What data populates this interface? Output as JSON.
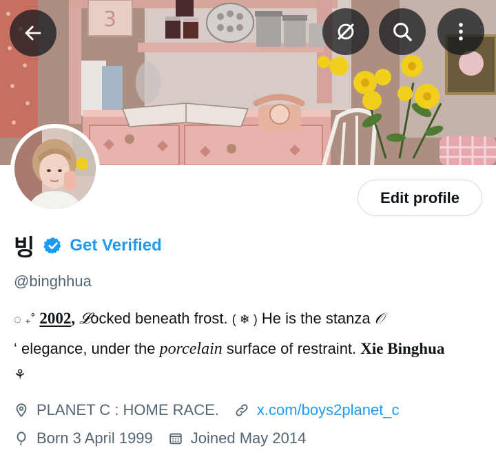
{
  "header": {
    "back_icon": "arrow-left-icon",
    "grok_icon": "grok-icon",
    "search_icon": "search-icon",
    "more_icon": "more-vertical-icon"
  },
  "profile": {
    "display_name": "빙",
    "verified_badge_icon": "verified-badge-icon",
    "get_verified_label": "Get Verified",
    "handle": "@binghhua",
    "edit_profile_label": "Edit profile"
  },
  "bio": {
    "line1": {
      "lead": "◌ ₊˚",
      "year": "2002",
      "comma": ",",
      "script_l": "𝓛",
      "text1": "ocked beneath frost.",
      "snow": "( ❄ )",
      "text2": "He is the stanza",
      "script_o": "𝒪"
    },
    "line2": {
      "tick": "‘",
      "text1": "elegance, under the",
      "porcelain": "porcelain",
      "text2": "surface of restraint.",
      "name": "Xie Binghua"
    },
    "line3": {
      "flower": "⚘"
    }
  },
  "meta": {
    "location_icon": "location-pin-icon",
    "location": "PLANET C : HOME RACE.",
    "link_icon": "link-icon",
    "url": "x.com/boys2planet_c",
    "birthday_icon": "balloon-icon",
    "born": "Born 3 April 1999",
    "joined_icon": "calendar-icon",
    "joined": "Joined May 2014"
  },
  "colors": {
    "accent": "#1d9bf0",
    "text": "#0f1419",
    "secondary_text": "#536471",
    "border": "#cfd9de"
  }
}
